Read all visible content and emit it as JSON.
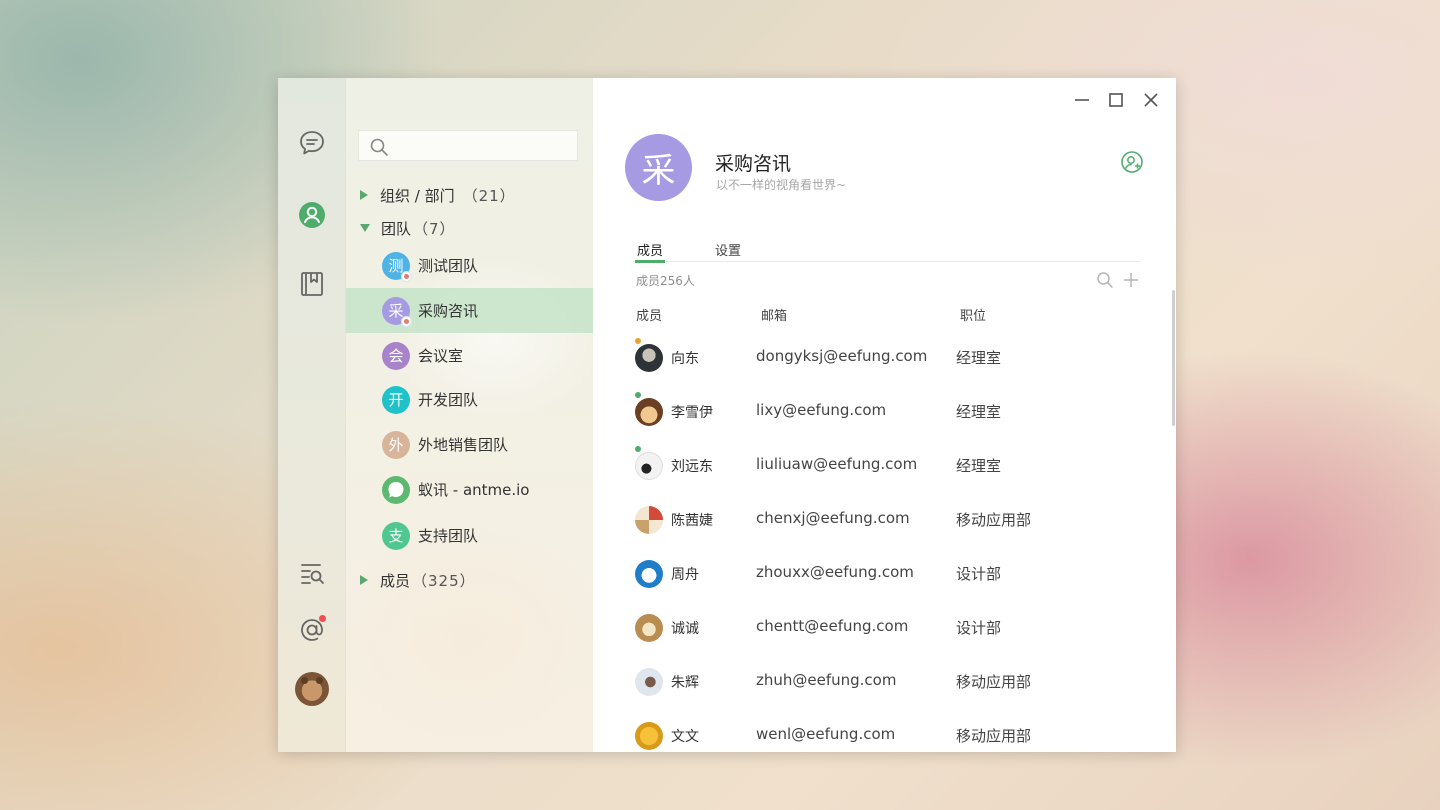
{
  "rail": {
    "icons": [
      "chat-icon",
      "contacts-icon",
      "notebook-icon",
      "search-list-icon",
      "mention-icon"
    ],
    "accent": "#4fad6c",
    "notification_color": "#f24d4d"
  },
  "sidebar": {
    "search": {
      "value": "",
      "placeholder": ""
    },
    "groups": {
      "org": {
        "label": "组织 / 部门",
        "count": "（21）"
      },
      "teams": {
        "label": "团队",
        "count": "（7）"
      },
      "members": {
        "label": "成员",
        "count": "（325）"
      }
    },
    "teams": [
      {
        "initial": "测",
        "name": "测试团队",
        "color": "#4fb3e6"
      },
      {
        "initial": "采",
        "name": "采购咨讯",
        "color": "#a69be3"
      },
      {
        "initial": "会",
        "name": "会议室",
        "color": "#a883c9"
      },
      {
        "initial": "开",
        "name": "开发团队",
        "color": "#1fc2c9"
      },
      {
        "initial": "外",
        "name": "外地销售团队",
        "color": "#d8b49a"
      },
      {
        "initial": "",
        "name": "蚁讯 - antme.io",
        "color": "#5db870"
      },
      {
        "initial": "支",
        "name": "支持团队",
        "color": "#50c78e"
      }
    ]
  },
  "main": {
    "window_controls": [
      "minimize-icon",
      "maximize-icon",
      "close-icon"
    ],
    "group": {
      "initial": "采",
      "title": "采购咨讯",
      "subtitle": "以不一样的视角看世界~"
    },
    "tabs": [
      {
        "label": "成员"
      },
      {
        "label": "设置"
      }
    ],
    "member_count": "成员256人",
    "columns": {
      "member": "成员",
      "email": "邮箱",
      "position": "职位"
    },
    "members": [
      {
        "name": "向东",
        "email": "dongyksj@eefung.com",
        "position": "经理室",
        "dot": "#f0a030"
      },
      {
        "name": "李雪伊",
        "email": "lixy@eefung.com",
        "position": "经理室",
        "dot": "#4fad6c"
      },
      {
        "name": "刘远东",
        "email": "liuliuaw@eefung.com",
        "position": "经理室",
        "dot": "#4fad6c"
      },
      {
        "name": "陈茜婕",
        "email": "chenxj@eefung.com",
        "position": "移动应用部",
        "dot": ""
      },
      {
        "name": "周舟",
        "email": "zhouxx@eefung.com",
        "position": "设计部",
        "dot": ""
      },
      {
        "name": "诚诚",
        "email": "chentt@eefung.com",
        "position": "设计部",
        "dot": ""
      },
      {
        "name": "朱辉",
        "email": "zhuh@eefung.com",
        "position": "移动应用部",
        "dot": ""
      },
      {
        "name": "文文",
        "email": "wenl@eefung.com",
        "position": "移动应用部",
        "dot": ""
      }
    ]
  }
}
